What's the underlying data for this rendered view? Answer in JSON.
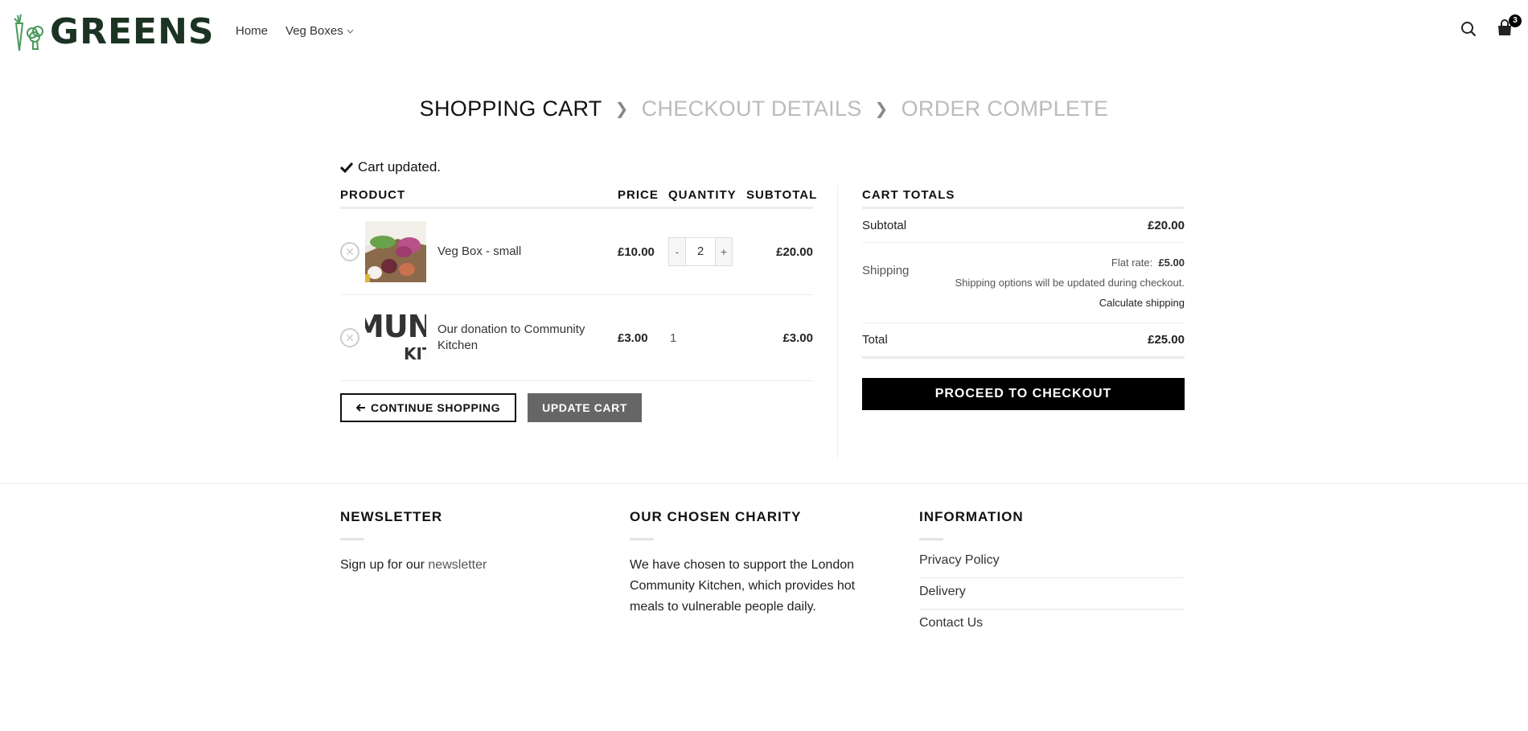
{
  "header": {
    "logo_text": "GREENS",
    "nav": [
      {
        "label": "Home"
      },
      {
        "label": "Veg Boxes"
      }
    ],
    "cart_count": "3"
  },
  "steps": {
    "current": "SHOPPING CART",
    "next": "CHECKOUT DETAILS",
    "last": "ORDER COMPLETE"
  },
  "notice": "Cart updated.",
  "cart": {
    "headers": {
      "product": "PRODUCT",
      "price": "PRICE",
      "quantity": "QUANTITY",
      "subtotal": "SUBTOTAL"
    },
    "items": [
      {
        "name": "Veg Box - small",
        "price": "£10.00",
        "qty": "2",
        "subtotal": "£20.00",
        "qty_minus": "-",
        "qty_plus": "+"
      },
      {
        "name": "Our donation to Community Kitchen",
        "price": "£3.00",
        "qty": "1",
        "subtotal": "£3.00",
        "thumb_text_1": "MUNI",
        "thumb_text_2": "KIT"
      }
    ],
    "continue_label": "CONTINUE SHOPPING",
    "update_label": "UPDATE CART"
  },
  "totals": {
    "title": "CART TOTALS",
    "subtotal_label": "Subtotal",
    "subtotal_value": "£20.00",
    "shipping_label": "Shipping",
    "flat_rate_label": "Flat rate:",
    "flat_rate_value": "£5.00",
    "shipping_note": "Shipping options will be updated during checkout.",
    "calc_shipping": "Calculate shipping",
    "total_label": "Total",
    "total_value": "£25.00",
    "checkout_label": "PROCEED TO CHECKOUT"
  },
  "footer": {
    "newsletter": {
      "title": "NEWSLETTER",
      "text_prefix": "Sign up for our",
      "link": "newsletter"
    },
    "charity": {
      "title": "OUR CHOSEN CHARITY",
      "text": "We have chosen to support the London Community Kitchen, which provides hot meals to vulnerable people daily."
    },
    "info": {
      "title": "INFORMATION",
      "links": [
        "Privacy Policy",
        "Delivery",
        "Contact Us"
      ]
    }
  }
}
